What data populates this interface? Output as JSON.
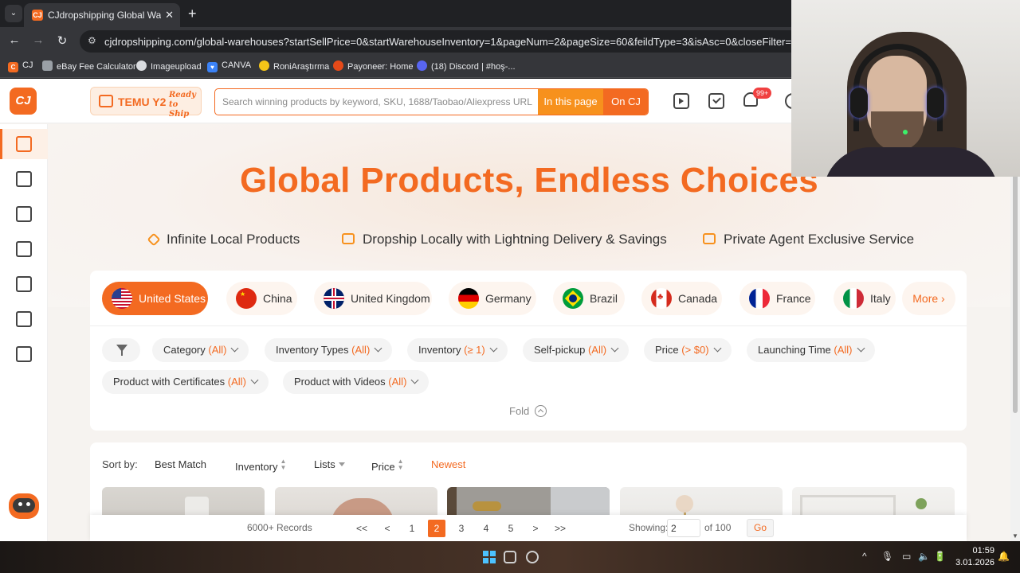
{
  "browser": {
    "tab": {
      "title": "CJdropshipping Global Warehouses",
      "favicon": "CJ",
      "close": "✕"
    },
    "new_tab": "+",
    "tab_dropdown": "⌄",
    "nav": {
      "back": "←",
      "forward": "→",
      "reload": "↻",
      "site_info": "⚙"
    },
    "url": "cjdropshipping.com/global-warehouses?startSellPrice=0&startWarehouseInventory=1&pageNum=2&pageSize=60&feildType=3&isAsc=0&closeFilter=false&searchValue=",
    "bookmarks": [
      {
        "label": "CJ",
        "icon": "cj-favicon",
        "color": "#f36a21"
      },
      {
        "label": "eBay Fee Calculator",
        "icon": "grid-favicon",
        "color": "#9aa0a6"
      },
      {
        "label": "Imageupload",
        "icon": "image-favicon",
        "color": "#dadce0"
      },
      {
        "label": "CANVA",
        "icon": "heart-favicon",
        "color": "#3b82f6"
      },
      {
        "label": "RoniAraştırma",
        "icon": "pacman-favicon",
        "color": "#f5c518"
      },
      {
        "label": "Payoneer: Home",
        "icon": "payoneer-favicon",
        "color": "#e64a19"
      },
      {
        "label": "(18) Discord | #hoş-...",
        "icon": "discord-favicon",
        "color": "#5865f2"
      }
    ]
  },
  "header": {
    "logo": "CJ",
    "temu": {
      "label": "TEMU Y2",
      "ready": "Ready to Ship"
    },
    "search": {
      "placeholder": "Search winning products by keyword, SKU, 1688/Taobao/Aliexpress URL",
      "value": "",
      "in_page_label": "In this page",
      "on_cj_label": "On CJ"
    },
    "notification_badge": "99+",
    "icons": [
      "video-icon",
      "task-check-icon",
      "bell-icon",
      "help-icon"
    ]
  },
  "sidebar": {
    "items": [
      {
        "icon": "global-search-icon",
        "active": true
      },
      {
        "icon": "cart-icon",
        "active": false
      },
      {
        "icon": "shopping-bag-icon",
        "active": false
      },
      {
        "icon": "clipboard-list-icon",
        "active": false
      },
      {
        "icon": "paperclip-icon",
        "active": false
      },
      {
        "icon": "store-check-icon",
        "active": false
      },
      {
        "icon": "monitor-chart-icon",
        "active": false
      }
    ],
    "assistant": "robot-assistant-icon"
  },
  "hero": {
    "title": "Global Products, Endless Choices",
    "features": [
      {
        "icon": "diamond-icon",
        "label": "Infinite Local Products"
      },
      {
        "icon": "delivery-box-icon",
        "label": "Dropship Locally with Lightning Delivery & Savings"
      },
      {
        "icon": "truck-icon",
        "label": "Private Agent Exclusive Service"
      }
    ]
  },
  "countries": {
    "items": [
      {
        "label": "United States",
        "active": true
      },
      {
        "label": "China",
        "active": false
      },
      {
        "label": "United Kingdom",
        "active": false
      },
      {
        "label": "Germany",
        "active": false
      },
      {
        "label": "Brazil",
        "active": false
      },
      {
        "label": "Canada",
        "active": false
      },
      {
        "label": "France",
        "active": false
      },
      {
        "label": "Italy",
        "active": false
      }
    ],
    "more_label": "More ›"
  },
  "filters": {
    "items": [
      {
        "label": "Category",
        "value": "(All)"
      },
      {
        "label": "Inventory Types",
        "value": "(All)"
      },
      {
        "label": "Inventory",
        "value": "(≥ 1)"
      },
      {
        "label": "Self-pickup",
        "value": "(All)"
      },
      {
        "label": "Price",
        "value": "(> $0)"
      },
      {
        "label": "Launching Time",
        "value": "(All)"
      },
      {
        "label": "Product with Certificates",
        "value": "(All)"
      },
      {
        "label": "Product with Videos",
        "value": "(All)"
      }
    ],
    "fold_label": "Fold"
  },
  "sort": {
    "label": "Sort by:",
    "options": [
      {
        "label": "Best Match",
        "indicator": "none",
        "active": false
      },
      {
        "label": "Inventory",
        "indicator": "updown",
        "active": false
      },
      {
        "label": "Lists",
        "indicator": "caret",
        "active": false
      },
      {
        "label": "Price",
        "indicator": "updown",
        "active": false
      },
      {
        "label": "Newest",
        "indicator": "none",
        "active": true
      }
    ]
  },
  "pagination": {
    "records": "6000+ Records",
    "first": "<<",
    "prev": "<",
    "pages": [
      "1",
      "2",
      "3",
      "4",
      "5"
    ],
    "current": "2",
    "next": ">",
    "last": ">>",
    "showing_label": "Showing:",
    "input_value": "2",
    "of_total": "of 100",
    "go_label": "Go"
  },
  "taskbar": {
    "time": "01:59",
    "date": "3.01.2026",
    "tray": [
      "^",
      "🎙",
      "▭",
      "🔈",
      "🔋",
      "🔔"
    ]
  },
  "colors": {
    "brand_orange": "#f36a21",
    "secondary_orange": "#f7911d",
    "chip_bg": "#fdf5ef"
  }
}
